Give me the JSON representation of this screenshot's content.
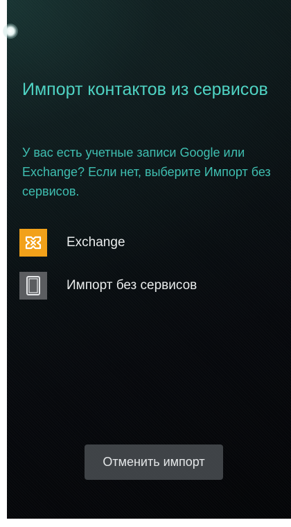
{
  "header": {
    "title": "Импорт контактов из сервисов"
  },
  "main": {
    "description": "У вас есть учетные записи Google или Exchange? Если нет, выберите Импорт без сервисов.",
    "options": [
      {
        "label": "Exchange",
        "icon": "exchange-icon",
        "icon_color": "#f2a11a"
      },
      {
        "label": "Импорт без сервисов",
        "icon": "phone-device-icon",
        "icon_color": "#5b5d60"
      }
    ]
  },
  "footer": {
    "cancel_label": "Отменить импорт"
  },
  "colors": {
    "accent": "#4fd3c3",
    "text_primary": "#e9ecec",
    "background": "#07090d"
  }
}
